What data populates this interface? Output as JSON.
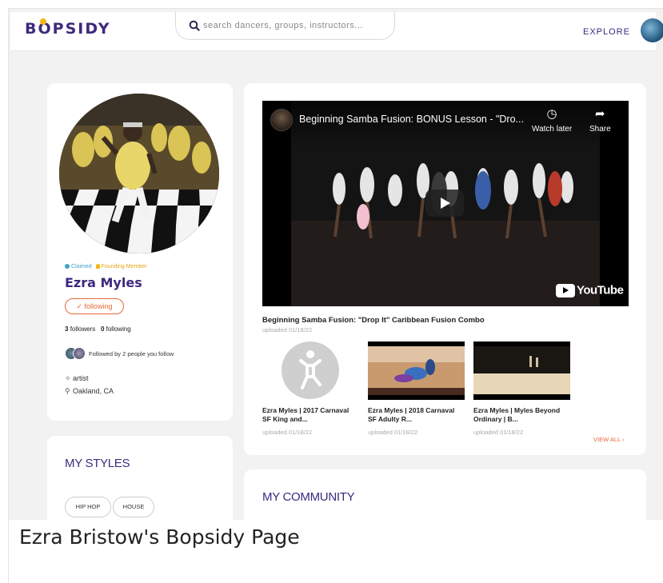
{
  "app": {
    "logo_text": "BOPSIDY",
    "logo_prefix": "B",
    "logo_o": "O",
    "logo_suffix": "PSIDY"
  },
  "search": {
    "placeholder": "search dancers, groups, instructors..."
  },
  "nav": {
    "explore_label": "EXPLORE"
  },
  "profile": {
    "badge_claimed": "Claimed",
    "badge_founding": "Founding Member",
    "name": "Ezra Myles",
    "following_button": "✓ following",
    "followers_count": "3",
    "followers_label": "followers",
    "following_count": "0",
    "following_label": "following",
    "followed_by_text": "Followed by 2 people you follow",
    "role": "artist",
    "location": "Oakland, CA"
  },
  "styles": {
    "title": "MY STYLES",
    "items": [
      "HIP HOP",
      "HOUSE"
    ]
  },
  "video": {
    "title": "Beginning Samba Fusion: BONUS Lesson - \"Dro...",
    "watch_later": "Watch later",
    "share": "Share",
    "yt_wordmark": "YouTube",
    "caption": "Beginning Samba Fusion: \"Drop It\" Caribbean Fusion Combo",
    "date": "uploaded 01/18/22"
  },
  "thumbnails": [
    {
      "title_line1": "Ezra Myles | 2017 Carnaval",
      "title_line2": "SF King and...",
      "date": "uploaded 01/18/22"
    },
    {
      "title_line1": "Ezra Myles | 2018 Carnaval",
      "title_line2": "SF Adulty R...",
      "date": "uploaded 01/18/22"
    },
    {
      "title_line1": "Ezra Myles | Myles Beyond",
      "title_line2": "Ordinary | B...",
      "date": "uploaded 01/18/22"
    }
  ],
  "view_all": "VIEW ALL ›",
  "community": {
    "title": "MY COMMUNITY"
  },
  "page_caption": "Ezra Bristow's Bopsidy Page",
  "colors": {
    "brand_purple": "#3d2a7d",
    "brand_yellow": "#f3b715",
    "accent_orange": "#e46a3a",
    "claimed_blue": "#3fa2c8"
  },
  "icons": [
    "search-icon",
    "watch-later-icon",
    "share-icon",
    "play-icon",
    "person-icon",
    "location-pin-icon",
    "check-icon"
  ]
}
